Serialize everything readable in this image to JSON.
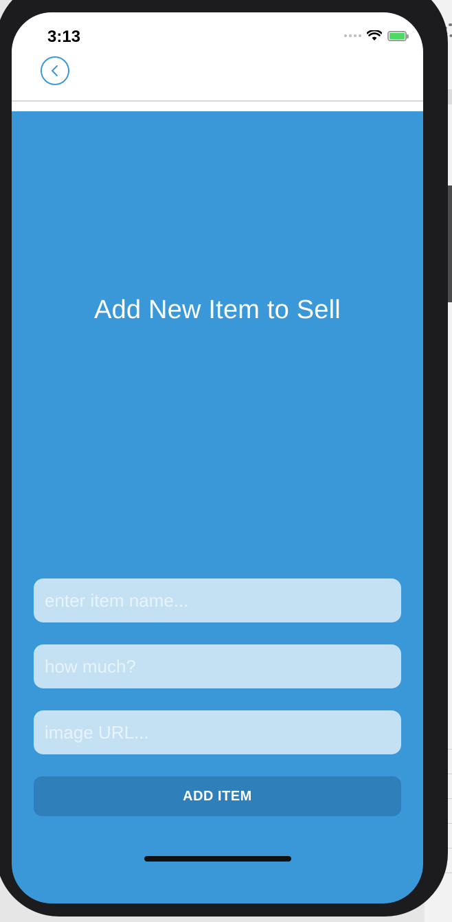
{
  "status_bar": {
    "time": "3:13"
  },
  "nav": {
    "back_icon": "chevron-left-icon"
  },
  "page": {
    "title": "Add New Item to Sell"
  },
  "form": {
    "item_name_placeholder": "enter item name...",
    "price_placeholder": "how much?",
    "image_url_placeholder": "image URL...",
    "submit_label": "ADD ITEM"
  },
  "colors": {
    "accent": "#3a98d8",
    "field_bg": "#c4e0f3",
    "button_bg": "#2f7fba",
    "header_bg": "#ffffff"
  }
}
